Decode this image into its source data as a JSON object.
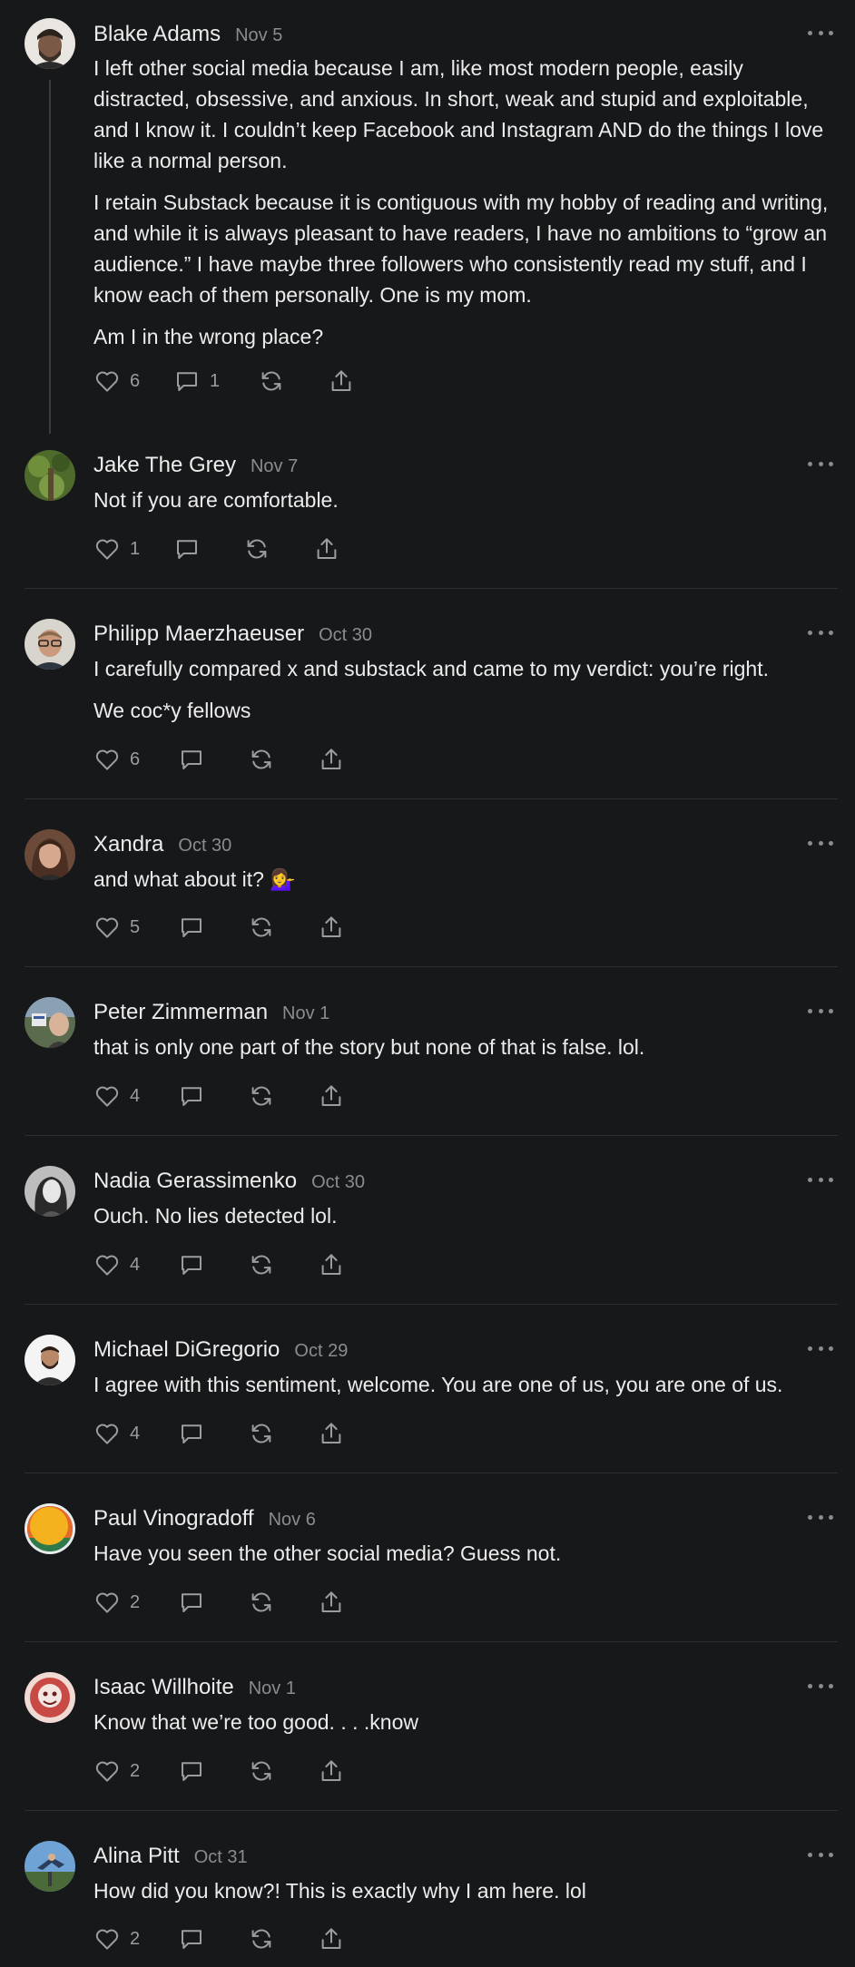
{
  "comments": [
    {
      "author": "Blake Adams",
      "date": "Nov 5",
      "paragraphs": [
        "I left other social media because I am, like most modern people, easily distracted, obsessive, and anxious. In short, weak and stupid and exploitable, and I know it. I couldn’t keep Facebook and Instagram AND do the things I love like a normal person.",
        "I retain Substack because it is contiguous with my hobby of reading and writing, and while it is always pleasant to have readers, I have no ambitions to “grow an audience.” I have maybe three followers who consistently read my stuff, and I know each of them personally. One is my mom.",
        "Am I in the wrong place?"
      ],
      "likes": "6",
      "replies": "1"
    },
    {
      "author": "Jake The Grey",
      "date": "Nov 7",
      "paragraphs": [
        "Not if you are comfortable."
      ],
      "likes": "1",
      "replies": ""
    },
    {
      "author": "Philipp Maerzhaeuser",
      "date": "Oct 30",
      "paragraphs": [
        "I carefully compared x and substack and came to my verdict: you’re right.",
        "We coc*y fellows"
      ],
      "likes": "6",
      "replies": ""
    },
    {
      "author": "Xandra",
      "date": "Oct 30",
      "paragraphs": [
        "and what about it? 💁‍♀️"
      ],
      "likes": "5",
      "replies": ""
    },
    {
      "author": "Peter Zimmerman",
      "date": "Nov 1",
      "paragraphs": [
        "that is only one part of the story but none of that is false. lol."
      ],
      "likes": "4",
      "replies": ""
    },
    {
      "author": "Nadia Gerassimenko",
      "date": "Oct 30",
      "paragraphs": [
        "Ouch. No lies detected lol."
      ],
      "likes": "4",
      "replies": ""
    },
    {
      "author": "Michael DiGregorio",
      "date": "Oct 29",
      "paragraphs": [
        "I agree with this sentiment, welcome. You are one of us, you are one of us."
      ],
      "likes": "4",
      "replies": ""
    },
    {
      "author": "Paul Vinogradoff",
      "date": "Nov 6",
      "paragraphs": [
        "Have you seen the other social media? Guess not."
      ],
      "likes": "2",
      "replies": ""
    },
    {
      "author": "Isaac Willhoite",
      "date": "Nov 1",
      "paragraphs": [
        "Know that we’re too good. . . .know"
      ],
      "likes": "2",
      "replies": ""
    },
    {
      "author": "Alina Pitt",
      "date": "Oct 31",
      "paragraphs": [
        "How did you know?! This is exactly why I am here. lol"
      ],
      "likes": "2",
      "replies": ""
    }
  ],
  "icons": {
    "like": "heart-icon",
    "reply": "comment-bubble-icon",
    "restack": "restack-arrows-icon",
    "share": "share-upload-icon",
    "more": "more-horizontal-icon"
  },
  "colors": {
    "background": "#17181a",
    "text": "#ececec",
    "muted": "#8a8c90",
    "divider": "#2c2e31"
  }
}
